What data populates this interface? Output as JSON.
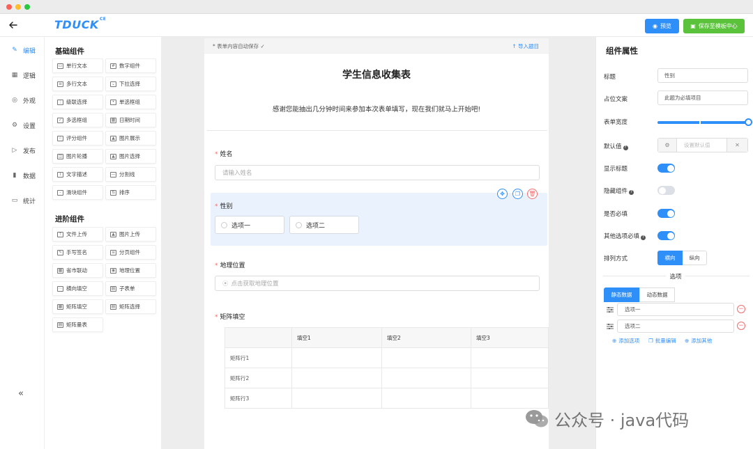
{
  "window": {
    "colors": {
      "close": "#fe5f57",
      "minimize": "#febc2e",
      "maximize": "#28c840"
    }
  },
  "header": {
    "logo_text": "TDUCK",
    "logo_sup": "CE",
    "preview_label": "预览",
    "save_template_label": "保存至模板中心",
    "colors": {
      "brand": "#2f8ff8",
      "save": "#5bc33b"
    }
  },
  "nav": {
    "items": [
      {
        "label": "编辑",
        "icon": "pencil-icon",
        "glyph": "✎",
        "active": true
      },
      {
        "label": "逻辑",
        "icon": "grid-icon",
        "glyph": "▦",
        "active": false
      },
      {
        "label": "外观",
        "icon": "eye-icon",
        "glyph": "◎",
        "active": false
      },
      {
        "label": "设置",
        "icon": "gear-icon",
        "glyph": "⚙",
        "active": false
      },
      {
        "label": "发布",
        "icon": "play-circle-icon",
        "glyph": "▷",
        "active": false
      },
      {
        "label": "数据",
        "icon": "bar-chart-icon",
        "glyph": "▮",
        "active": false
      },
      {
        "label": "统计",
        "icon": "monitor-icon",
        "glyph": "▭",
        "active": false
      }
    ],
    "collapse_glyph": "«"
  },
  "palette": {
    "basic_title": "基础组件",
    "basic": [
      {
        "label": "单行文本",
        "icon": "single-line-icon",
        "glyph": "▭"
      },
      {
        "label": "数字组件",
        "icon": "number-icon",
        "glyph": "#"
      },
      {
        "label": "多行文本",
        "icon": "multi-line-icon",
        "glyph": "≡"
      },
      {
        "label": "下拉选择",
        "icon": "dropdown-icon",
        "glyph": "⌄"
      },
      {
        "label": "级联选择",
        "icon": "cascade-icon",
        "glyph": "⋮"
      },
      {
        "label": "单选框组",
        "icon": "radio-icon",
        "glyph": "•"
      },
      {
        "label": "多选框组",
        "icon": "checkbox-icon",
        "glyph": "✓"
      },
      {
        "label": "日期时间",
        "icon": "calendar-icon",
        "glyph": "▦"
      },
      {
        "label": "评分组件",
        "icon": "star-icon",
        "glyph": "☆"
      },
      {
        "label": "图片展示",
        "icon": "image-icon",
        "glyph": "▲"
      },
      {
        "label": "图片轮播",
        "icon": "carousel-icon",
        "glyph": "◫"
      },
      {
        "label": "图片选择",
        "icon": "image-select-icon",
        "glyph": "▲"
      },
      {
        "label": "文字描述",
        "icon": "text-icon",
        "glyph": "T"
      },
      {
        "label": "分割线",
        "icon": "divider-icon",
        "glyph": "—"
      },
      {
        "label": "滑块组件",
        "icon": "slider-icon",
        "glyph": "-"
      },
      {
        "label": "排序",
        "icon": "sort-icon",
        "glyph": "⇅"
      }
    ],
    "advanced_title": "进阶组件",
    "advanced": [
      {
        "label": "文件上传",
        "icon": "upload-icon",
        "glyph": "⇡"
      },
      {
        "label": "图片上传",
        "icon": "image-upload-icon",
        "glyph": "▲"
      },
      {
        "label": "手写签名",
        "icon": "signature-icon",
        "glyph": "✎"
      },
      {
        "label": "分页组件",
        "icon": "pagination-icon",
        "glyph": "≡"
      },
      {
        "label": "省市联动",
        "icon": "region-icon",
        "glyph": "▦"
      },
      {
        "label": "地理位置",
        "icon": "location-icon",
        "glyph": "◉"
      },
      {
        "label": "横向填空",
        "icon": "horizontal-fill-icon",
        "glyph": "⋯"
      },
      {
        "label": "子表单",
        "icon": "subform-icon",
        "glyph": "▤"
      },
      {
        "label": "矩阵填空",
        "icon": "matrix-fill-icon",
        "glyph": "▦"
      },
      {
        "label": "矩阵选择",
        "icon": "matrix-select-icon",
        "glyph": "▤"
      },
      {
        "label": "矩阵量表",
        "icon": "matrix-scale-icon",
        "glyph": "▤"
      }
    ]
  },
  "form": {
    "autosave_text": "* 表单内容自动保存 ✓",
    "import_text": "↑  导入题目",
    "title": "学生信息收集表",
    "description": "感谢您能抽出几分钟时间来参加本次表单填写，现在我们就马上开始吧!",
    "name_field": {
      "label": "姓名",
      "placeholder": "请输入姓名"
    },
    "gender_field": {
      "label": "性别",
      "options": [
        "选项一",
        "选项二"
      ]
    },
    "location_field": {
      "label": "地理位置",
      "placeholder": "点击获取地理位置"
    },
    "matrix_field": {
      "label": "矩阵填空",
      "columns": [
        "填空1",
        "填空2",
        "填空3"
      ],
      "rows": [
        "矩阵行1",
        "矩阵行2",
        "矩阵行3"
      ]
    }
  },
  "props": {
    "title": "组件属性",
    "label_title": "标题",
    "value_title": "性别",
    "label_placeholder": "占位文案",
    "value_placeholder": "此题为必填项目",
    "label_width": "表单宽度",
    "width_percent": 100,
    "label_default": "默认值",
    "default_placeholder": "设置默认值",
    "label_show_title": "显示标题",
    "show_title": true,
    "label_hidden": "隐藏组件",
    "hidden": false,
    "label_required": "是否必填",
    "required": true,
    "label_other_required": "其他选项必填",
    "other_required": true,
    "label_arrange": "排列方式",
    "arrange_horizontal": "横向",
    "arrange_vertical": "纵向",
    "options_heading": "选项",
    "tab_static": "静态数据",
    "tab_dynamic": "动态数据",
    "options": [
      "选项一",
      "选项二"
    ],
    "add_option": "添加选项",
    "batch_edit": "批量编辑",
    "add_other": "添加其他"
  },
  "watermark": {
    "text": "公众号 · java代码"
  }
}
